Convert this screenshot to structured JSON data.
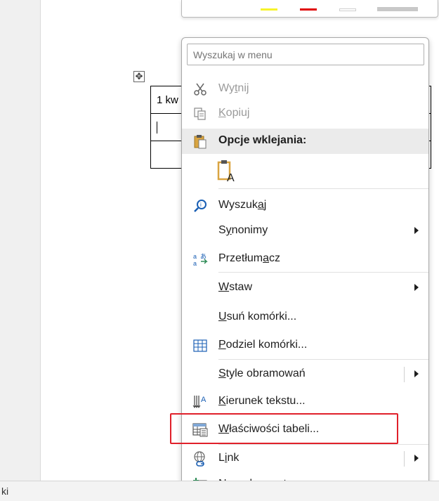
{
  "status_bar": {
    "text": "ki"
  },
  "toolbar": {
    "swatches": [
      {
        "name": "yellow",
        "color": "#f7f32a"
      },
      {
        "name": "red",
        "color": "#e00000"
      },
      {
        "name": "white",
        "color": "#ffffff"
      },
      {
        "name": "gray",
        "color": "#c8c8c8"
      }
    ]
  },
  "document": {
    "table_first_cell": "1 kw"
  },
  "menu": {
    "search_placeholder": "Wyszukaj w menu",
    "cut": {
      "pre": "Wy",
      "acc": "t",
      "post": "nij"
    },
    "copy": {
      "pre": "",
      "acc": "K",
      "post": "opiuj"
    },
    "paste_options_header": "Opcje wklejania:",
    "search": {
      "pre": "Wyszuk",
      "acc": "a",
      "post": "j"
    },
    "synonyms": {
      "pre": "S",
      "acc": "y",
      "post": "nonimy"
    },
    "translate": {
      "pre": "Przetłum",
      "acc": "a",
      "post": "cz"
    },
    "insert": {
      "pre": "",
      "acc": "W",
      "post": "staw"
    },
    "delete_cells": {
      "pre": "",
      "acc": "U",
      "post": "suń komórki..."
    },
    "split_cells": {
      "pre": "",
      "acc": "P",
      "post": "odziel komórki..."
    },
    "border_styles": {
      "pre": "",
      "acc": "S",
      "post": "tyle obramowań"
    },
    "text_direction": {
      "pre": "",
      "acc": "K",
      "post": "ierunek tekstu..."
    },
    "table_properties": {
      "pre": "",
      "acc": "W",
      "post": "łaściwości tabeli..."
    },
    "link": {
      "pre": "L",
      "acc": "i",
      "post": "nk"
    },
    "new_comment": {
      "pre": "Nowy komentar",
      "acc": "z",
      "post": ""
    }
  },
  "icons": {
    "cut": "scissors-icon",
    "copy": "copy-icon",
    "paste": "paste-icon",
    "search": "search-icon",
    "translate": "translate-icon",
    "split_cells": "split-cells-icon",
    "text_direction": "text-direction-icon",
    "table_properties": "table-properties-icon",
    "link": "link-icon",
    "new_comment": "new-comment-icon"
  },
  "highlight_color": "#e0202a"
}
